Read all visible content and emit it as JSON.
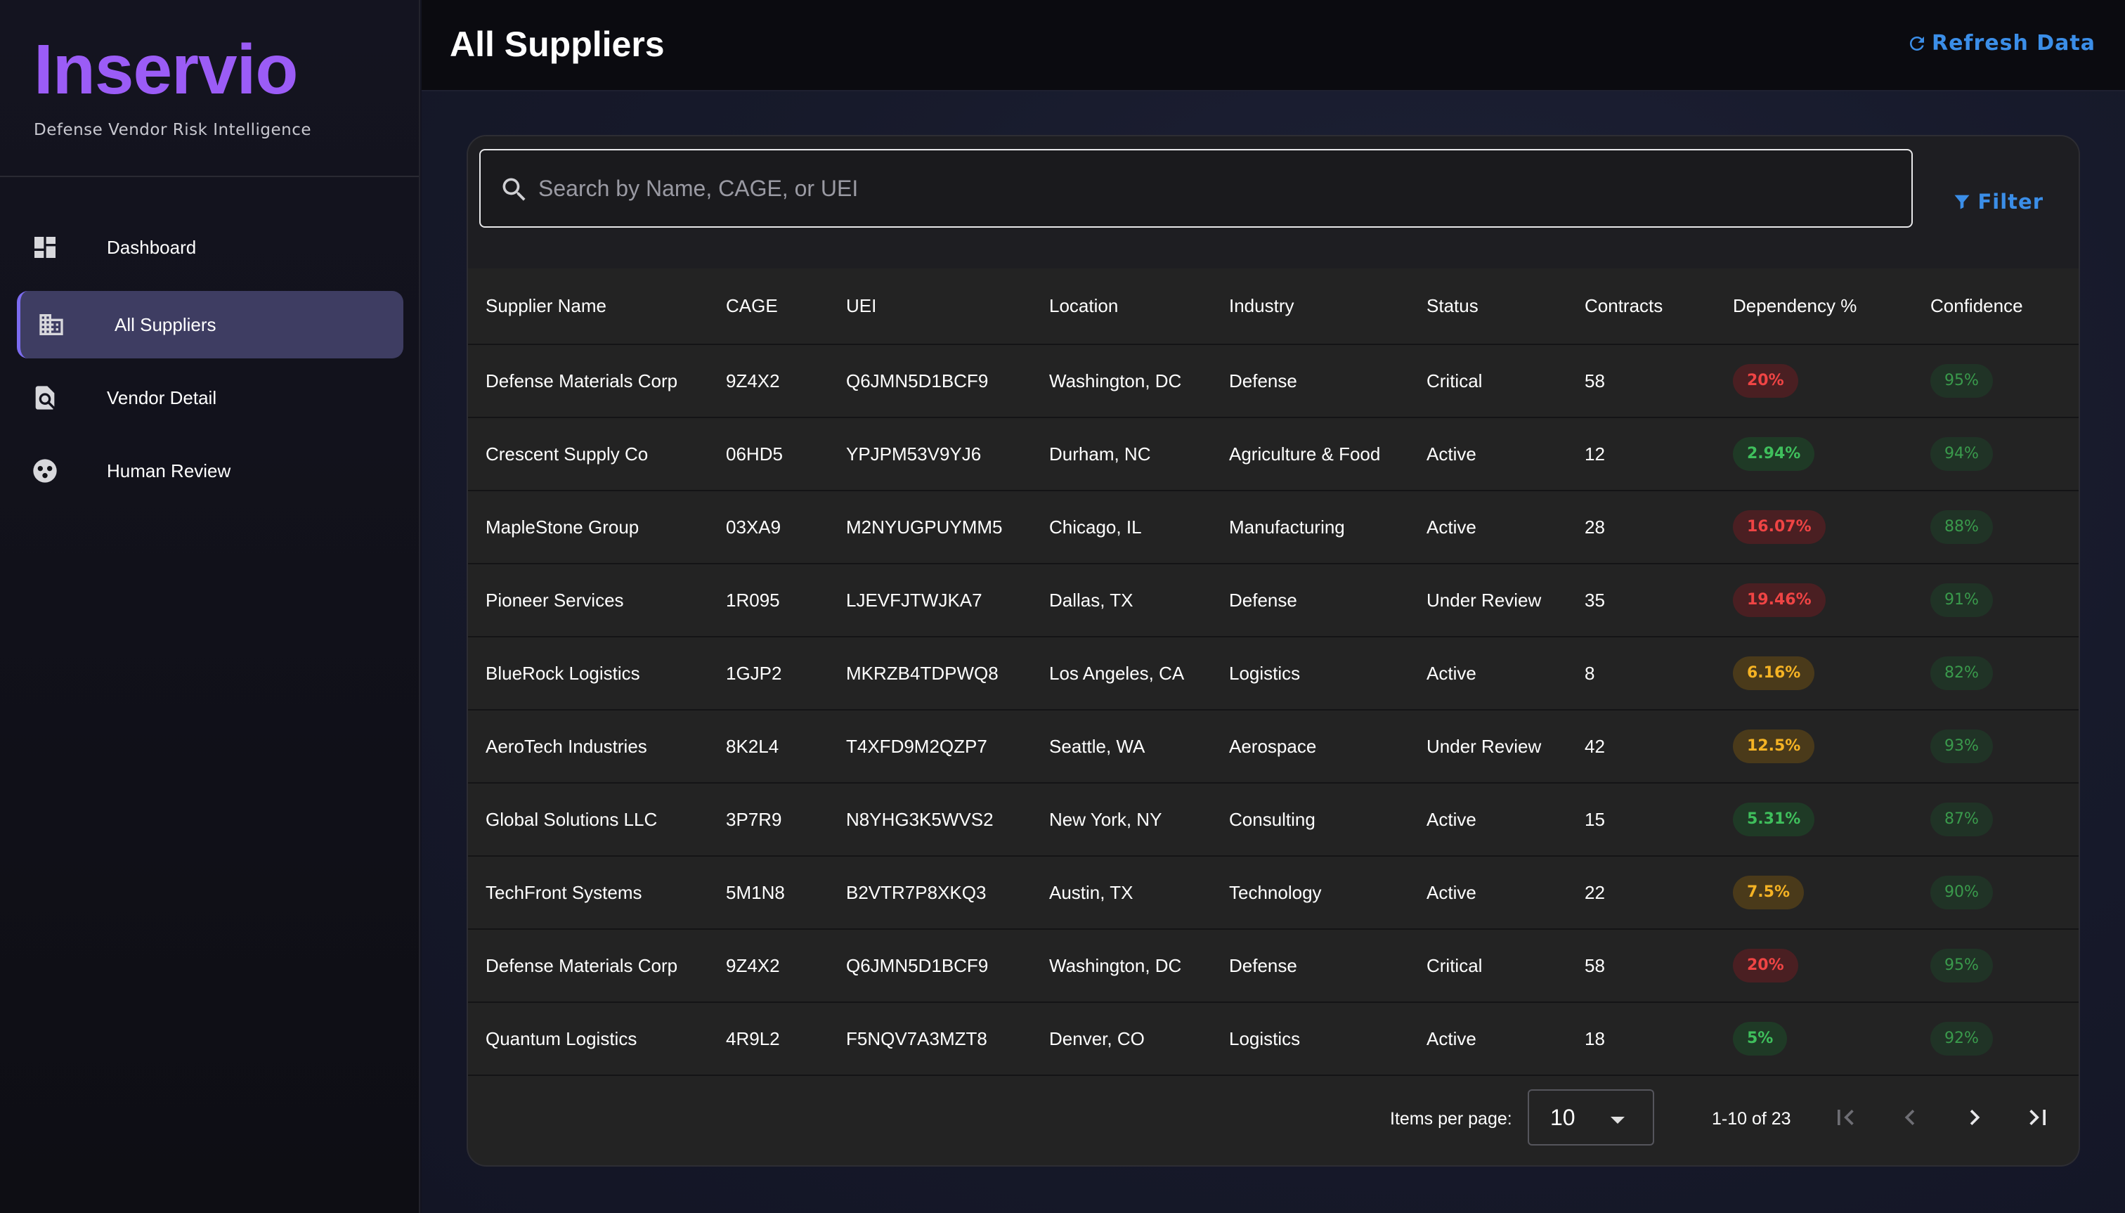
{
  "brand": {
    "name": "Inservio",
    "tagline": "Defense Vendor Risk Intelligence"
  },
  "sidebar": {
    "items": [
      {
        "label": "Dashboard",
        "icon": "dashboard-icon",
        "active": false
      },
      {
        "label": "All Suppliers",
        "icon": "business-icon",
        "active": true
      },
      {
        "label": "Vendor Detail",
        "icon": "document-search-icon",
        "active": false
      },
      {
        "label": "Human Review",
        "icon": "face-icon",
        "active": false
      }
    ]
  },
  "header": {
    "title": "All Suppliers",
    "refresh_label": "Refresh Data"
  },
  "search": {
    "placeholder": "Search by Name, CAGE, or UEI",
    "value": ""
  },
  "filter_label": "Filter",
  "table": {
    "columns": [
      "Supplier Name",
      "CAGE",
      "UEI",
      "Location",
      "Industry",
      "Status",
      "Contracts",
      "Dependency %",
      "Confidence"
    ],
    "rows": [
      {
        "name": "Defense Materials Corp",
        "cage": "9Z4X2",
        "uei": "Q6JMN5D1BCF9",
        "location": "Washington, DC",
        "industry": "Defense",
        "status": "Critical",
        "contracts": "58",
        "dependency": "20%",
        "dependency_level": "high",
        "confidence": "95%"
      },
      {
        "name": "Crescent Supply Co",
        "cage": "06HD5",
        "uei": "YPJPM53V9YJ6",
        "location": "Durham, NC",
        "industry": "Agriculture & Food",
        "status": "Active",
        "contracts": "12",
        "dependency": "2.94%",
        "dependency_level": "low",
        "confidence": "94%"
      },
      {
        "name": "MapleStone Group",
        "cage": "03XA9",
        "uei": "M2NYUGPUYMM5",
        "location": "Chicago, IL",
        "industry": "Manufacturing",
        "status": "Active",
        "contracts": "28",
        "dependency": "16.07%",
        "dependency_level": "high",
        "confidence": "88%"
      },
      {
        "name": "Pioneer Services",
        "cage": "1R095",
        "uei": "LJEVFJTWJKA7",
        "location": "Dallas, TX",
        "industry": "Defense",
        "status": "Under Review",
        "contracts": "35",
        "dependency": "19.46%",
        "dependency_level": "high",
        "confidence": "91%"
      },
      {
        "name": "BlueRock Logistics",
        "cage": "1GJP2",
        "uei": "MKRZB4TDPWQ8",
        "location": "Los Angeles, CA",
        "industry": "Logistics",
        "status": "Active",
        "contracts": "8",
        "dependency": "6.16%",
        "dependency_level": "medium",
        "confidence": "82%"
      },
      {
        "name": "AeroTech Industries",
        "cage": "8K2L4",
        "uei": "T4XFD9M2QZP7",
        "location": "Seattle, WA",
        "industry": "Aerospace",
        "status": "Under Review",
        "contracts": "42",
        "dependency": "12.5%",
        "dependency_level": "medium",
        "confidence": "93%"
      },
      {
        "name": "Global Solutions LLC",
        "cage": "3P7R9",
        "uei": "N8YHG3K5WVS2",
        "location": "New York, NY",
        "industry": "Consulting",
        "status": "Active",
        "contracts": "15",
        "dependency": "5.31%",
        "dependency_level": "low",
        "confidence": "87%"
      },
      {
        "name": "TechFront Systems",
        "cage": "5M1N8",
        "uei": "B2VTR7P8XKQ3",
        "location": "Austin, TX",
        "industry": "Technology",
        "status": "Active",
        "contracts": "22",
        "dependency": "7.5%",
        "dependency_level": "medium",
        "confidence": "90%"
      },
      {
        "name": "Defense Materials Corp",
        "cage": "9Z4X2",
        "uei": "Q6JMN5D1BCF9",
        "location": "Washington, DC",
        "industry": "Defense",
        "status": "Critical",
        "contracts": "58",
        "dependency": "20%",
        "dependency_level": "high",
        "confidence": "95%"
      },
      {
        "name": "Quantum Logistics",
        "cage": "4R9L2",
        "uei": "F5NQV7A3MZT8",
        "location": "Denver, CO",
        "industry": "Logistics",
        "status": "Active",
        "contracts": "18",
        "dependency": "5%",
        "dependency_level": "low",
        "confidence": "92%"
      }
    ]
  },
  "paginator": {
    "items_per_page_label": "Items per page:",
    "items_per_page": "10",
    "range_label": "1-10 of 23"
  },
  "colors": {
    "accent": "#9b5cf6",
    "link": "#3b8ee8",
    "high": "#ef4444",
    "medium": "#f5b324",
    "low": "#3fbf5c",
    "confidence": "#3a9a4c"
  }
}
